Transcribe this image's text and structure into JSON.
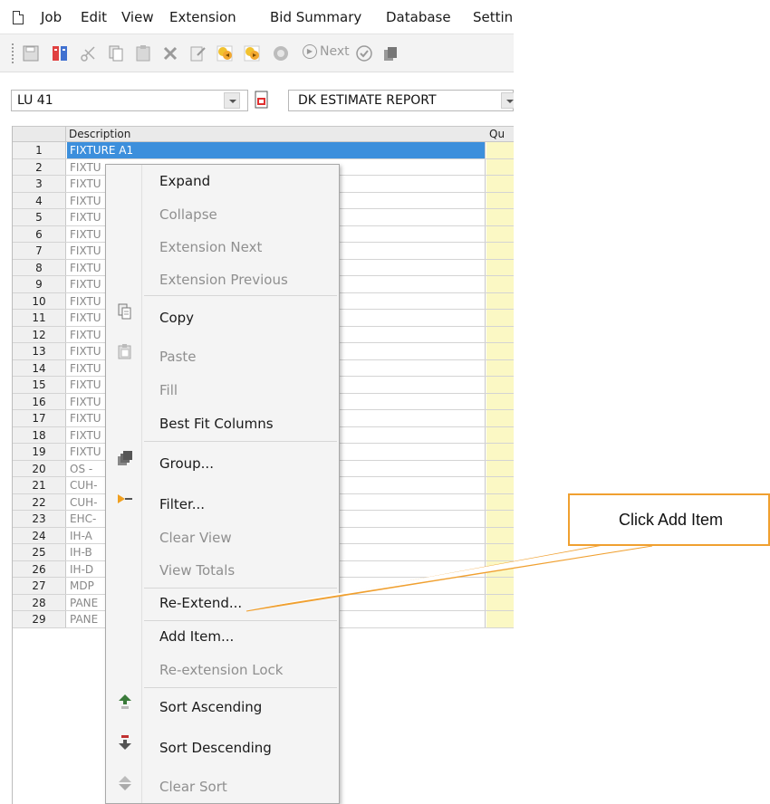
{
  "menubar": {
    "items": [
      "Job",
      "Edit",
      "View",
      "Extension",
      "Bid Summary",
      "Database",
      "Settin"
    ]
  },
  "toolbar": {
    "next_label": "Next"
  },
  "selectors": {
    "job": "LU 41",
    "report": "DK ESTIMATE REPORT"
  },
  "grid": {
    "columns": [
      "Description",
      "Qu"
    ],
    "rows": [
      {
        "num": "1",
        "desc": "FIXTURE A1"
      },
      {
        "num": "2",
        "desc": "FIXTU"
      },
      {
        "num": "3",
        "desc": "FIXTU"
      },
      {
        "num": "4",
        "desc": "FIXTU"
      },
      {
        "num": "5",
        "desc": "FIXTU"
      },
      {
        "num": "6",
        "desc": "FIXTU"
      },
      {
        "num": "7",
        "desc": "FIXTU"
      },
      {
        "num": "8",
        "desc": "FIXTU"
      },
      {
        "num": "9",
        "desc": "FIXTU"
      },
      {
        "num": "10",
        "desc": "FIXTU"
      },
      {
        "num": "11",
        "desc": "FIXTU"
      },
      {
        "num": "12",
        "desc": "FIXTU"
      },
      {
        "num": "13",
        "desc": "FIXTU"
      },
      {
        "num": "14",
        "desc": "FIXTU"
      },
      {
        "num": "15",
        "desc": "FIXTU"
      },
      {
        "num": "16",
        "desc": "FIXTU"
      },
      {
        "num": "17",
        "desc": "FIXTU"
      },
      {
        "num": "18",
        "desc": "FIXTU"
      },
      {
        "num": "19",
        "desc": "FIXTU"
      },
      {
        "num": "20",
        "desc": "OS -"
      },
      {
        "num": "21",
        "desc": "CUH-"
      },
      {
        "num": "22",
        "desc": "CUH-"
      },
      {
        "num": "23",
        "desc": "EHC-"
      },
      {
        "num": "24",
        "desc": "IH-A"
      },
      {
        "num": "25",
        "desc": "IH-B"
      },
      {
        "num": "26",
        "desc": "IH-D"
      },
      {
        "num": "27",
        "desc": "MDP"
      },
      {
        "num": "28",
        "desc": "PANE"
      },
      {
        "num": "29",
        "desc": "PANE"
      }
    ]
  },
  "context_menu": {
    "expand": "Expand",
    "collapse": "Collapse",
    "extension_next": "Extension Next",
    "extension_previous": "Extension Previous",
    "copy": "Copy",
    "paste": "Paste",
    "fill": "Fill",
    "best_fit_columns": "Best Fit Columns",
    "group": "Group...",
    "filter": "Filter...",
    "clear_view": "Clear View",
    "view_totals": "View Totals",
    "re_extend": "Re-Extend...",
    "add_item": "Add Item...",
    "re_extension_lock": "Re-extension Lock",
    "sort_ascending": "Sort Ascending",
    "sort_descending": "Sort Descending",
    "clear_sort": "Clear Sort"
  },
  "callout": {
    "text": "Click Add Item",
    "color": "#f0a030"
  },
  "colors": {
    "selection": "#3c8fdc",
    "quantity_column": "#fbf8c4"
  }
}
